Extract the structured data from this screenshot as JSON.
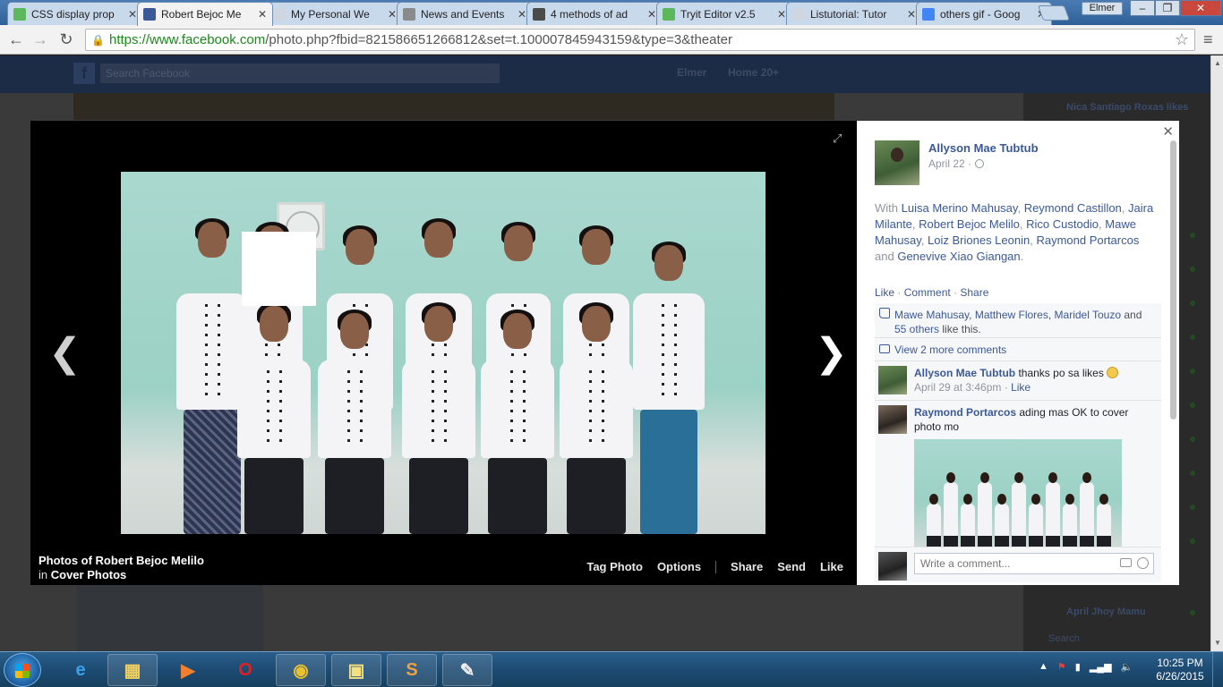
{
  "browser": {
    "tabs": [
      {
        "label": "CSS display prop",
        "favicon_color": "#5cb85c"
      },
      {
        "label": "Robert Bejoc Me",
        "favicon_color": "#3b5998",
        "active": true
      },
      {
        "label": "My Personal We",
        "favicon_color": "#cfd6e0"
      },
      {
        "label": "News and Events",
        "favicon_color": "#8a8a8a"
      },
      {
        "label": "4 methods of ad",
        "favicon_color": "#4a4a4a"
      },
      {
        "label": "Tryit Editor v2.5",
        "favicon_color": "#5cb85c"
      },
      {
        "label": "Listutorial: Tutor",
        "favicon_color": "#cfd6e0"
      },
      {
        "label": "others gif - Goog",
        "favicon_color": "#4285f4"
      }
    ],
    "window_user": "Elmer",
    "window_controls": [
      "–",
      "❐",
      "✕"
    ],
    "url_secure": "https://www.facebook.com",
    "url_rest": "/photo.php?fbid=821586651266812&set=t.100007845943159&type=3&theater"
  },
  "fb_header": {
    "search_placeholder": "Search Facebook",
    "user_name": "Elmer",
    "home_label": "Home",
    "home_count": "20+"
  },
  "background": {
    "ticker_top": "Nica Santiago Roxas likes",
    "chat_bottom": "April Jhoy Mamu",
    "chat_search": "Search"
  },
  "theater": {
    "caption_title": "Photos of Robert Bejoc Melilo",
    "caption_in": "in",
    "caption_album": "Cover Photos",
    "actions": [
      "Tag Photo",
      "Options",
      "Share",
      "Send",
      "Like"
    ]
  },
  "panel": {
    "author": "Allyson Mae Tubtub",
    "date": "April 22 ·",
    "with_prefix": "With",
    "with_people": [
      "Luisa Merino Mahusay",
      "Reymond Castillon",
      "Jaira Milante",
      "Robert Bejoc Melilo",
      "Rico Custodio",
      "Mawe Mahusay",
      "Loiz Briones Leonin",
      "Raymond Portarcos"
    ],
    "with_and": "and",
    "with_last": "Genevive Xiao Giangan",
    "like": "Like",
    "comment": "Comment",
    "share": "Share",
    "likers": [
      "Mawe Mahusay",
      "Matthew Flores",
      "Maridel Touzo"
    ],
    "likers_and": "and",
    "likers_others": "55 others",
    "likers_suffix": "like this.",
    "view_more": "View 2 more comments",
    "comments": [
      {
        "name": "Allyson Mae Tubtub",
        "text": "thanks po sa likes",
        "meta": "April 29 at 3:46pm ·",
        "meta_link": "Like"
      },
      {
        "name": "Raymond Portarcos",
        "text": "ading mas OK to cover photo mo"
      }
    ],
    "write_placeholder": "Write a comment..."
  },
  "taskbar": {
    "time": "10:25 PM",
    "date": "6/26/2015"
  }
}
